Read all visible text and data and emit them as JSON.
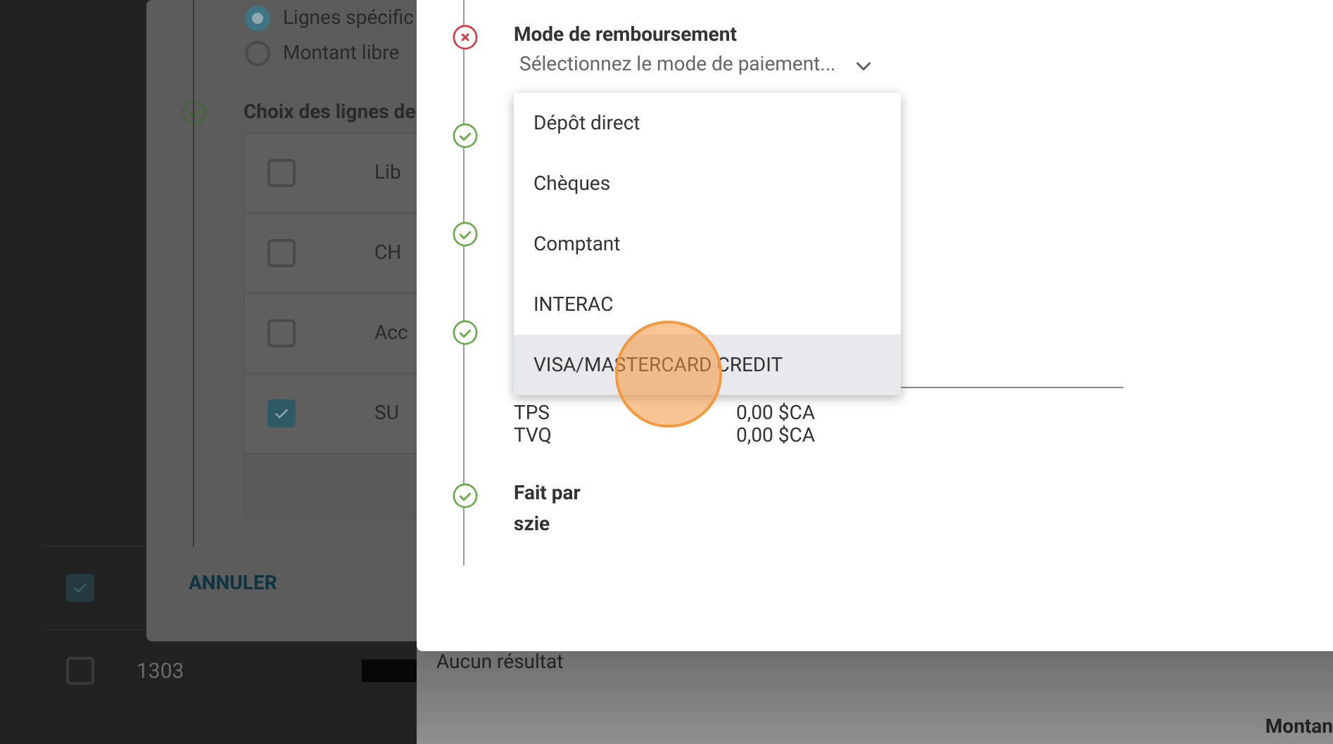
{
  "background_page": {
    "rows": [
      {
        "checked": true,
        "cells": []
      },
      {
        "checked": false,
        "cells": [
          "1303"
        ]
      }
    ],
    "empty_message": "Aucun résultat",
    "column_header": "Montan"
  },
  "back_dialog": {
    "radios": [
      {
        "label": "Lignes spécific",
        "selected": true
      },
      {
        "label": "Montant libre",
        "selected": false
      }
    ],
    "section_title": "Choix des lignes de",
    "rows": [
      {
        "label": "Lib",
        "checked": false
      },
      {
        "label": "CH",
        "checked": false
      },
      {
        "label": "Acc",
        "checked": false
      },
      {
        "label": "SU",
        "checked": true
      }
    ],
    "cancel_button": "ANNULER"
  },
  "panel": {
    "steps": [
      {
        "kind": "select",
        "error": true,
        "title": "Mode de remboursement",
        "placeholder": "Sélectionnez le mode de paiement..."
      },
      {
        "kind": "blank",
        "error": false
      },
      {
        "kind": "field",
        "error": false
      },
      {
        "kind": "amounts",
        "error": false,
        "lines": [
          {
            "label": "TPS",
            "value": "0,00 $CA"
          },
          {
            "label": "TVQ",
            "value": "0,00 $CA"
          }
        ]
      },
      {
        "kind": "author",
        "error": false,
        "title": "Fait par",
        "value": "szie"
      }
    ]
  },
  "menu": {
    "items": [
      {
        "label": "Dépôt direct",
        "selected": false
      },
      {
        "label": "Chèques",
        "selected": false
      },
      {
        "label": "Comptant",
        "selected": false
      },
      {
        "label": "INTERAC",
        "selected": false
      },
      {
        "label": "VISA/MASTERCARD CREDIT",
        "selected": true
      }
    ]
  }
}
